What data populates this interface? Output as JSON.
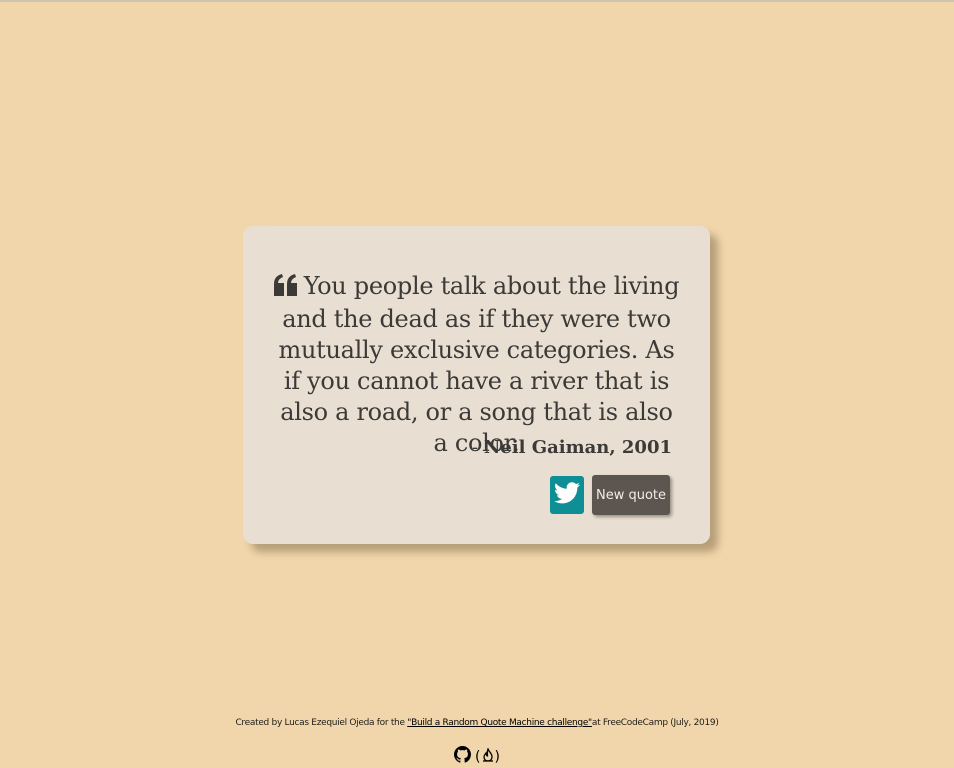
{
  "quote": {
    "text": "You people talk about the living and the dead as if they were two mutually exclusive categories. As if you cannot have a river that is also a road, or a song that is also a color.",
    "author_prefix": "- ",
    "author": "Neil Gaiman, 2001"
  },
  "buttons": {
    "tweet_icon": "twitter-icon",
    "new_quote_label": "New quote"
  },
  "footer": {
    "credit_prefix": "Created by Lucas Ezequiel Ojeda for the ",
    "challenge_link": "\"Build a Random Quote Machine challenge\"",
    "credit_suffix": "at FreeCodeCamp (July, 2019)",
    "paren_open": "(",
    "paren_close": ")"
  },
  "colors": {
    "background": "#f1d6ab",
    "card": "#e8ded1",
    "twitter": "#0e8f96",
    "button": "#5c5651",
    "text": "#3b3a38"
  }
}
